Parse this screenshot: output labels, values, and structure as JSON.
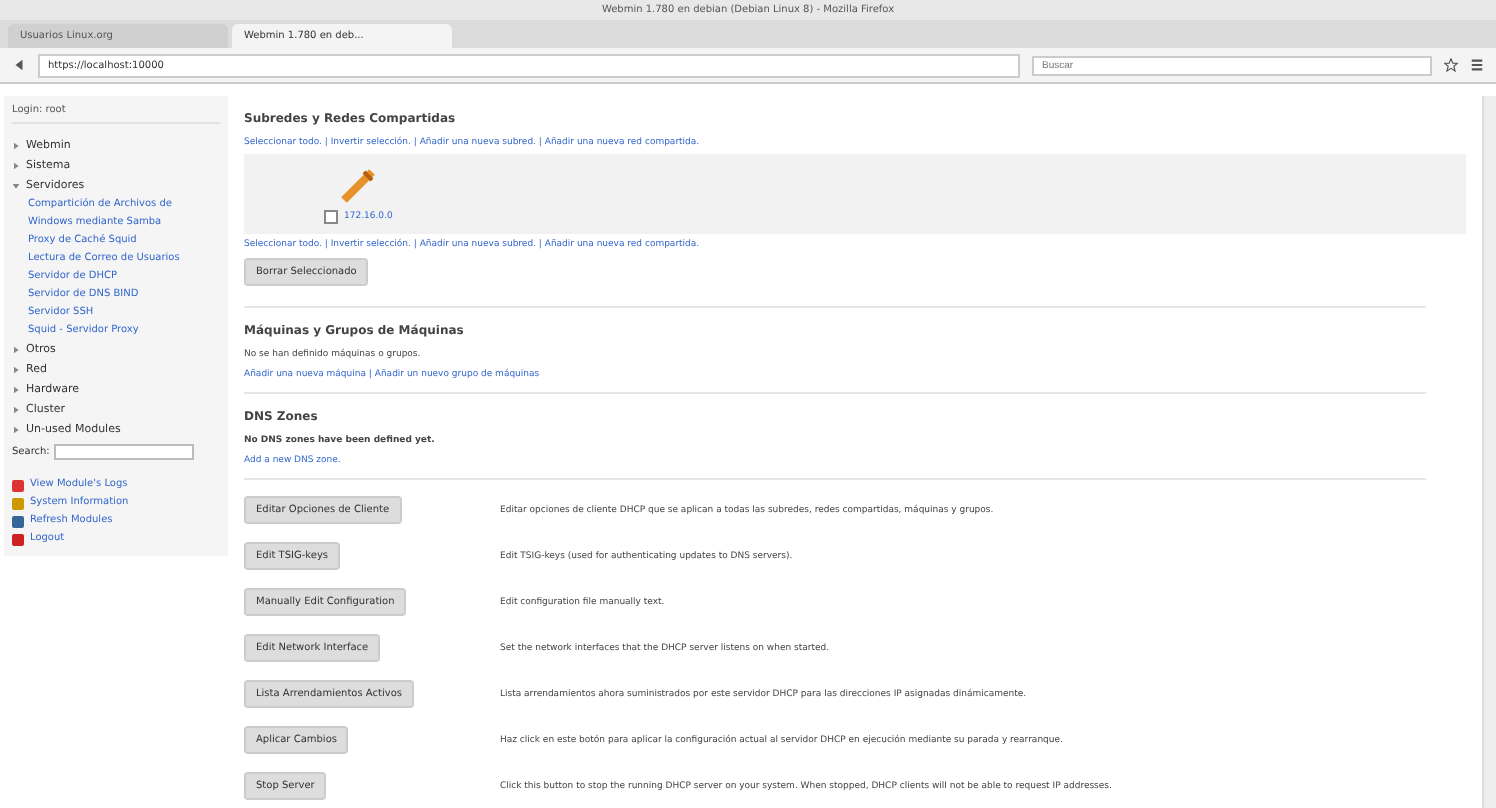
{
  "window": {
    "title": "Webmin 1.780 en debian (Debian Linux 8) - Mozilla Firefox"
  },
  "tabs": [
    {
      "label": "Usuarios Linux.org",
      "selected": false
    },
    {
      "label": "Webmin 1.780 en deb...",
      "selected": true
    }
  ],
  "address_bar": {
    "value": "https://localhost:10000"
  },
  "search": {
    "placeholder": "Buscar"
  },
  "sidebar": {
    "login": "Login: root",
    "items": [
      {
        "label": "Webmin",
        "expanded": false
      },
      {
        "label": "Sistema",
        "expanded": false
      },
      {
        "label": "Servidores",
        "expanded": true,
        "children": [
          {
            "label": "Compartición de Archivos de"
          },
          {
            "label": "Windows mediante Samba"
          },
          {
            "label": "Proxy de Caché Squid"
          },
          {
            "label": "Lectura de Correo de Usuarios"
          },
          {
            "label": "Servidor de DHCP"
          },
          {
            "label": "Servidor de DNS BIND"
          },
          {
            "label": "Servidor SSH"
          },
          {
            "label": "Squid - Servidor Proxy"
          }
        ]
      },
      {
        "label": "Otros",
        "expanded": false
      },
      {
        "label": "Red",
        "expanded": false
      },
      {
        "label": "Hardware",
        "expanded": false
      },
      {
        "label": "Cluster",
        "expanded": false
      },
      {
        "label": "Un-used Modules",
        "expanded": false
      }
    ],
    "search_label": "Search:",
    "links": [
      {
        "kind": "warning",
        "label": "View Module's Logs"
      },
      {
        "kind": "info",
        "label": "System Information"
      },
      {
        "kind": "refresh",
        "label": "Refresh Modules"
      },
      {
        "kind": "logout",
        "label": "Logout"
      }
    ]
  },
  "subnets": {
    "title": "Subredes y Redes Compartidas",
    "links": "Seleccionar todo. | Invertir selección. | Añadir una nueva subred. | Añadir una nueva red compartida.",
    "items": [
      {
        "label": "172.16.0.0",
        "checked": false
      }
    ],
    "links_bottom": "Seleccionar todo. | Invertir selección. | Añadir una nueva subred. | Añadir una nueva red compartida.",
    "button": "Borrar Seleccionado"
  },
  "hosts": {
    "title": "Máquinas y Grupos de Máquinas",
    "text": "No se han definido máquinas o grupos.",
    "links": "Añadir una nueva máquina | Añadir un nuevo grupo de máquinas"
  },
  "dns_zones": {
    "title": "DNS Zones",
    "text": "No DNS zones have been defined yet.",
    "link": "Add a new DNS zone."
  },
  "actions": [
    {
      "button": "Editar Opciones de Cliente",
      "description": "Editar opciones de cliente DHCP que se aplican a todas las subredes, redes compartidas, máquinas y grupos."
    },
    {
      "button": "Edit TSIG-keys",
      "description": "Edit TSIG-keys (used for authenticating updates to DNS servers)."
    },
    {
      "button": "Manually Edit Configuration",
      "description": "Edit configuration file manually text."
    },
    {
      "button": "Edit Network Interface",
      "description": "Set the network interfaces that the DHCP server listens on when started."
    },
    {
      "button": "Lista Arrendamientos Activos",
      "description": "Lista arrendamientos ahora suministrados por este servidor DHCP para las direcciones IP asignadas dinámicamente."
    },
    {
      "button": "Aplicar Cambios",
      "description": "Haz click en este botón para aplicar la configuración actual al servidor DHCP en ejecución mediante su parada y rearranque."
    },
    {
      "button": "Stop Server",
      "description": "Click this button to stop the running DHCP server on your system. When stopped, DHCP clients will not be able to request IP addresses."
    }
  ]
}
